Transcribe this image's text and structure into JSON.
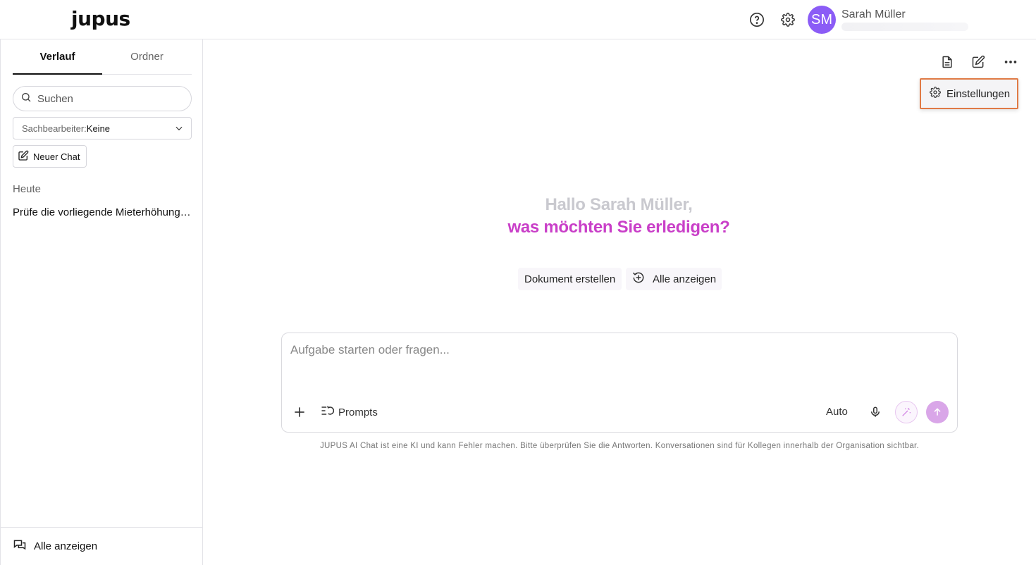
{
  "header": {
    "logo": "jupus",
    "user_initials": "SM",
    "user_name": "Sarah Müller"
  },
  "sidebar": {
    "tabs": [
      {
        "label": "Verlauf",
        "active": true
      },
      {
        "label": "Ordner",
        "active": false
      }
    ],
    "search_placeholder": "Suchen",
    "filter_label": "Sachbearbeiter:",
    "filter_value": "Keine",
    "new_chat_label": "Neuer Chat",
    "section_today": "Heute",
    "history": [
      "Prüfe die vorliegende Mieterhöhung …"
    ],
    "footer_label": "Alle anzeigen"
  },
  "main": {
    "dropdown_item": "Einstellungen",
    "greeting_line1": "Hallo Sarah Müller,",
    "greeting_line2": "was möchten Sie erledigen?",
    "chip_create_document": "Dokument erstellen",
    "chip_show_all": "Alle anzeigen",
    "composer_placeholder": "Aufgabe starten oder fragen...",
    "prompts_label": "Prompts",
    "model_label": "Auto",
    "disclaimer": "JUPUS AI Chat ist eine KI und kann Fehler machen. Bitte überprüfen Sie die Antworten. Konversationen sind für Kollegen innerhalb der Organisation sichtbar."
  },
  "colors": {
    "accent_magenta": "#c93fc8",
    "avatar_purple": "#8b5cf6",
    "dropdown_border": "#e07a45"
  }
}
